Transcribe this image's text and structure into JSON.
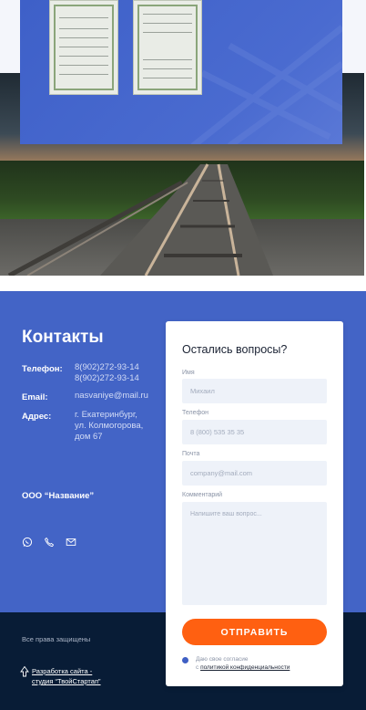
{
  "contacts": {
    "title": "Контакты",
    "phone_label": "Телефон:",
    "phones": [
      "8(902)272-93-14",
      "8(902)272-93-14"
    ],
    "email_label": "Email:",
    "email": "nasvaniye@mail.ru",
    "address_label": "Адрес:",
    "address_lines": [
      "г. Екатеринбург,",
      "ул. Колмогорова,",
      "дом 67"
    ],
    "company": "ООО “Название”",
    "social_icons": [
      "whatsapp-icon",
      "phone-icon",
      "mail-icon"
    ]
  },
  "form": {
    "title": "Остались вопросы?",
    "name_label": "Имя",
    "name_placeholder": "Михаил",
    "phone_label": "Телефон",
    "phone_placeholder": "8 (800) 535 35 35",
    "email_label": "Почта",
    "email_placeholder": "company@mail.com",
    "comment_label": "Комментарий",
    "comment_placeholder": "Напишите ваш вопрос...",
    "submit_label": "ОТПРАВИТЬ",
    "consent_text": "Даю свое согласие",
    "consent_prefix": "с ",
    "consent_link": "политикой конфиденциальности"
  },
  "footer": {
    "rights": "Все права защищены",
    "dev_line1": "Разработка сайта -",
    "dev_line2": "студия “ТвойСтартап”"
  },
  "colors": {
    "accent_blue": "#4364c6",
    "button_orange": "#ff6011",
    "footer_navy": "#081c36"
  }
}
